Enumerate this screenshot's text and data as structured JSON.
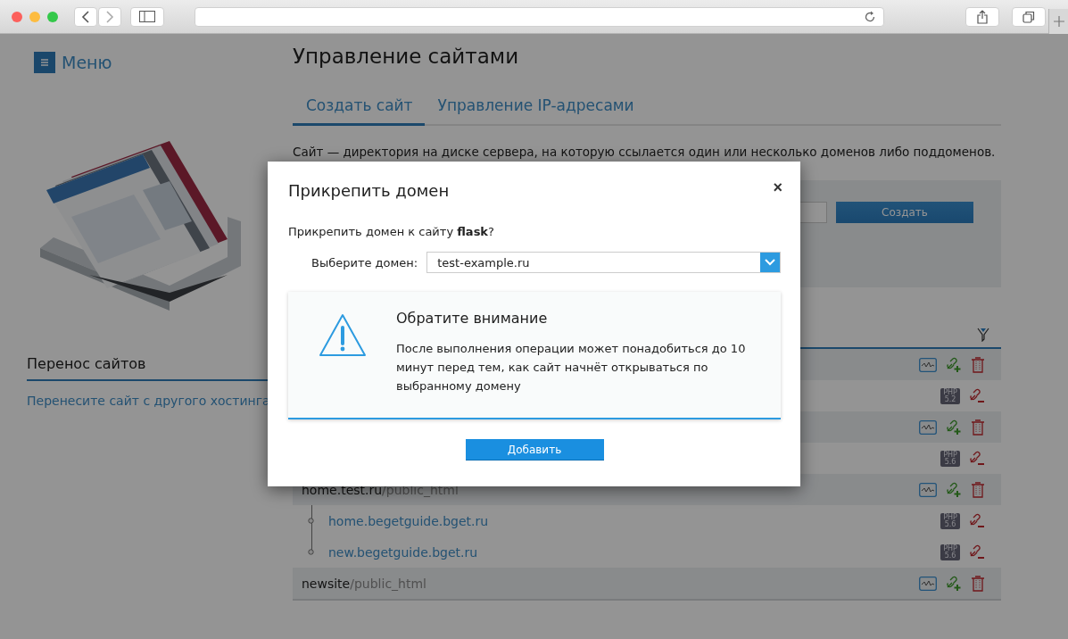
{
  "sidebar": {
    "menu_label": "Меню",
    "migration": {
      "title": "Перенос сайтов",
      "link": "Перенесите сайт с другого хостинга"
    }
  },
  "main": {
    "title": "Управление сайтами",
    "tabs": [
      {
        "label": "Создать сайт",
        "selected": true
      },
      {
        "label": "Управление IP-адресами",
        "selected": false
      }
    ],
    "description": "Сайт — директория на диске сервера, на которую ссылается один или несколько доменов либо поддоменов.",
    "create_button": "Создать",
    "rows": [
      {
        "kind": "site"
      },
      {
        "kind": "domain",
        "php_label": "PHP",
        "php_version": "5.2"
      },
      {
        "kind": "site"
      },
      {
        "kind": "domain",
        "php_label": "PHP",
        "php_version": "5.6"
      },
      {
        "kind": "site",
        "name": "home.test.ru",
        "path": "/public_html"
      },
      {
        "kind": "domain",
        "name": "home.begetguide.bget.ru",
        "php_label": "PHP",
        "php_version": "5.6"
      },
      {
        "kind": "domain",
        "name": "new.begetguide.bget.ru",
        "php_label": "PHP",
        "php_version": "5.6"
      },
      {
        "kind": "site",
        "name": "newsite",
        "path": "/public_html"
      }
    ]
  },
  "dialog": {
    "title": "Прикрепить домен",
    "close": "×",
    "question": "Прикрепить домен к сайту **flask**?",
    "select_label": "Выберите домен:",
    "select_value": "test-example.ru",
    "notice": {
      "title": "Обратите внимание",
      "text": "После выполнения операции может понадобиться до 10 минут перед тем, как сайт начнёт открываться по выбранному домену"
    },
    "submit": "Добавить"
  }
}
